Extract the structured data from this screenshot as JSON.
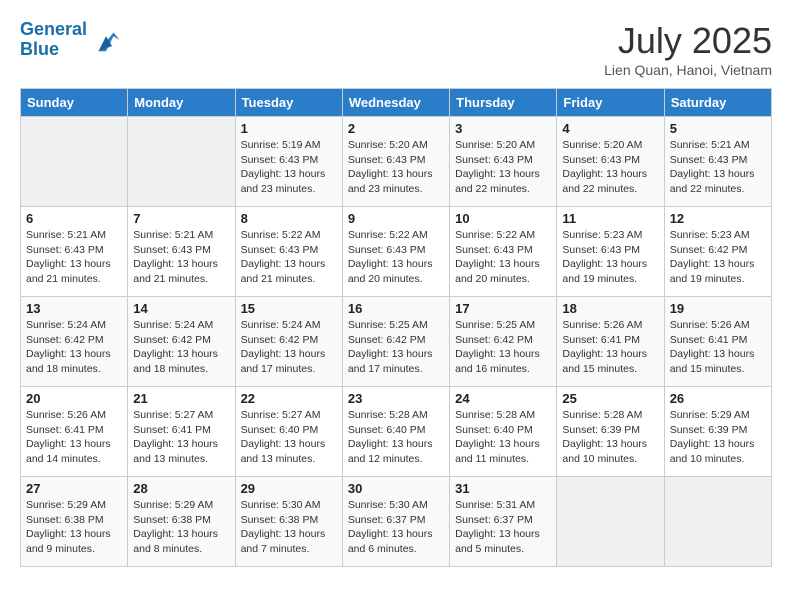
{
  "header": {
    "logo_line1": "General",
    "logo_line2": "Blue",
    "month_title": "July 2025",
    "location": "Lien Quan, Hanoi, Vietnam"
  },
  "days_of_week": [
    "Sunday",
    "Monday",
    "Tuesday",
    "Wednesday",
    "Thursday",
    "Friday",
    "Saturday"
  ],
  "weeks": [
    [
      {
        "day": "",
        "info": ""
      },
      {
        "day": "",
        "info": ""
      },
      {
        "day": "1",
        "sunrise": "5:19 AM",
        "sunset": "6:43 PM",
        "daylight": "13 hours and 23 minutes."
      },
      {
        "day": "2",
        "sunrise": "5:20 AM",
        "sunset": "6:43 PM",
        "daylight": "13 hours and 23 minutes."
      },
      {
        "day": "3",
        "sunrise": "5:20 AM",
        "sunset": "6:43 PM",
        "daylight": "13 hours and 22 minutes."
      },
      {
        "day": "4",
        "sunrise": "5:20 AM",
        "sunset": "6:43 PM",
        "daylight": "13 hours and 22 minutes."
      },
      {
        "day": "5",
        "sunrise": "5:21 AM",
        "sunset": "6:43 PM",
        "daylight": "13 hours and 22 minutes."
      }
    ],
    [
      {
        "day": "6",
        "sunrise": "5:21 AM",
        "sunset": "6:43 PM",
        "daylight": "13 hours and 21 minutes."
      },
      {
        "day": "7",
        "sunrise": "5:21 AM",
        "sunset": "6:43 PM",
        "daylight": "13 hours and 21 minutes."
      },
      {
        "day": "8",
        "sunrise": "5:22 AM",
        "sunset": "6:43 PM",
        "daylight": "13 hours and 21 minutes."
      },
      {
        "day": "9",
        "sunrise": "5:22 AM",
        "sunset": "6:43 PM",
        "daylight": "13 hours and 20 minutes."
      },
      {
        "day": "10",
        "sunrise": "5:22 AM",
        "sunset": "6:43 PM",
        "daylight": "13 hours and 20 minutes."
      },
      {
        "day": "11",
        "sunrise": "5:23 AM",
        "sunset": "6:43 PM",
        "daylight": "13 hours and 19 minutes."
      },
      {
        "day": "12",
        "sunrise": "5:23 AM",
        "sunset": "6:42 PM",
        "daylight": "13 hours and 19 minutes."
      }
    ],
    [
      {
        "day": "13",
        "sunrise": "5:24 AM",
        "sunset": "6:42 PM",
        "daylight": "13 hours and 18 minutes."
      },
      {
        "day": "14",
        "sunrise": "5:24 AM",
        "sunset": "6:42 PM",
        "daylight": "13 hours and 18 minutes."
      },
      {
        "day": "15",
        "sunrise": "5:24 AM",
        "sunset": "6:42 PM",
        "daylight": "13 hours and 17 minutes."
      },
      {
        "day": "16",
        "sunrise": "5:25 AM",
        "sunset": "6:42 PM",
        "daylight": "13 hours and 17 minutes."
      },
      {
        "day": "17",
        "sunrise": "5:25 AM",
        "sunset": "6:42 PM",
        "daylight": "13 hours and 16 minutes."
      },
      {
        "day": "18",
        "sunrise": "5:26 AM",
        "sunset": "6:41 PM",
        "daylight": "13 hours and 15 minutes."
      },
      {
        "day": "19",
        "sunrise": "5:26 AM",
        "sunset": "6:41 PM",
        "daylight": "13 hours and 15 minutes."
      }
    ],
    [
      {
        "day": "20",
        "sunrise": "5:26 AM",
        "sunset": "6:41 PM",
        "daylight": "13 hours and 14 minutes."
      },
      {
        "day": "21",
        "sunrise": "5:27 AM",
        "sunset": "6:41 PM",
        "daylight": "13 hours and 13 minutes."
      },
      {
        "day": "22",
        "sunrise": "5:27 AM",
        "sunset": "6:40 PM",
        "daylight": "13 hours and 13 minutes."
      },
      {
        "day": "23",
        "sunrise": "5:28 AM",
        "sunset": "6:40 PM",
        "daylight": "13 hours and 12 minutes."
      },
      {
        "day": "24",
        "sunrise": "5:28 AM",
        "sunset": "6:40 PM",
        "daylight": "13 hours and 11 minutes."
      },
      {
        "day": "25",
        "sunrise": "5:28 AM",
        "sunset": "6:39 PM",
        "daylight": "13 hours and 10 minutes."
      },
      {
        "day": "26",
        "sunrise": "5:29 AM",
        "sunset": "6:39 PM",
        "daylight": "13 hours and 10 minutes."
      }
    ],
    [
      {
        "day": "27",
        "sunrise": "5:29 AM",
        "sunset": "6:38 PM",
        "daylight": "13 hours and 9 minutes."
      },
      {
        "day": "28",
        "sunrise": "5:29 AM",
        "sunset": "6:38 PM",
        "daylight": "13 hours and 8 minutes."
      },
      {
        "day": "29",
        "sunrise": "5:30 AM",
        "sunset": "6:38 PM",
        "daylight": "13 hours and 7 minutes."
      },
      {
        "day": "30",
        "sunrise": "5:30 AM",
        "sunset": "6:37 PM",
        "daylight": "13 hours and 6 minutes."
      },
      {
        "day": "31",
        "sunrise": "5:31 AM",
        "sunset": "6:37 PM",
        "daylight": "13 hours and 5 minutes."
      },
      {
        "day": "",
        "info": ""
      },
      {
        "day": "",
        "info": ""
      }
    ]
  ],
  "labels": {
    "sunrise_prefix": "Sunrise: ",
    "sunset_prefix": "Sunset: ",
    "daylight_prefix": "Daylight: "
  }
}
